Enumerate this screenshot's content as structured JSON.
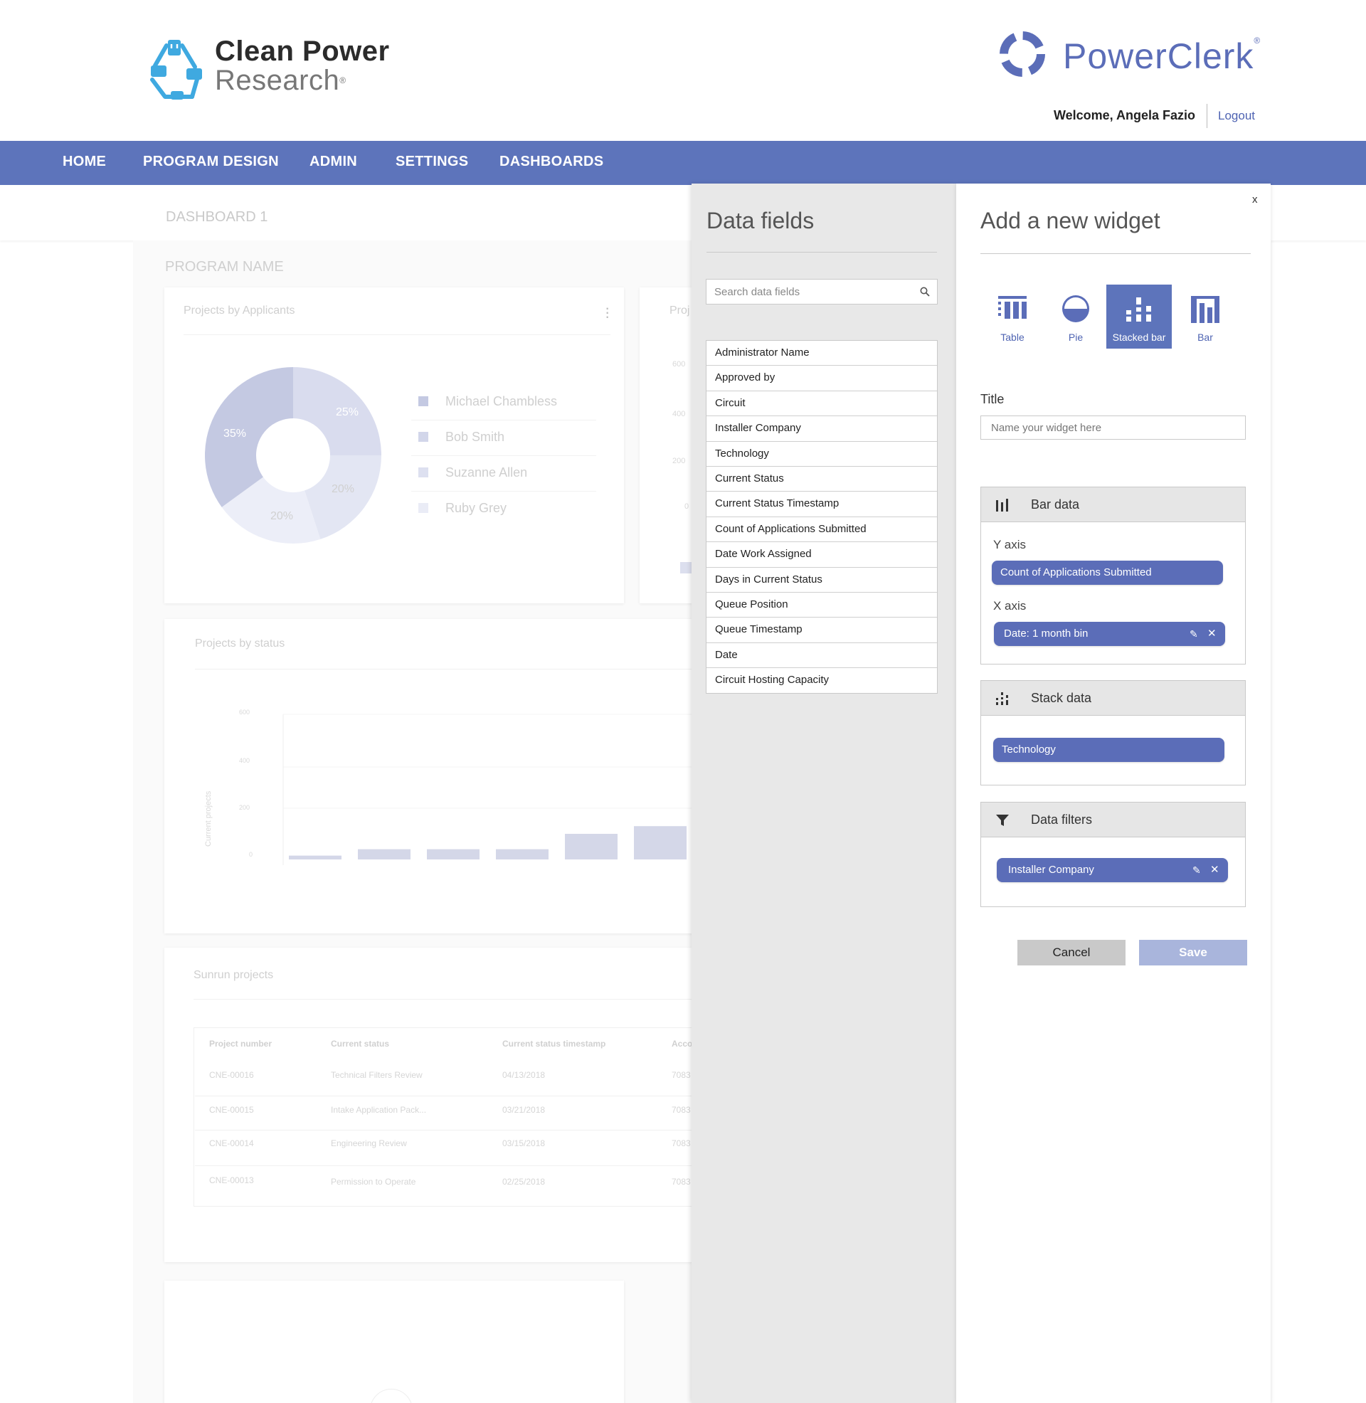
{
  "brand": {
    "company_line1": "Clean Power",
    "company_line2": "Research",
    "registered": "®",
    "product": "PowerClerk",
    "colors": {
      "accent": "#5d74bb",
      "pill": "#5b6db8",
      "logo_blue": "#3fa9e0"
    }
  },
  "user": {
    "welcome": "Welcome, Angela Fazio",
    "logout": "Logout"
  },
  "nav": {
    "items": [
      "HOME",
      "PROGRAM DESIGN",
      "ADMIN",
      "SETTINGS",
      "DASHBOARDS"
    ]
  },
  "dashboard": {
    "title": "DASHBOARD 1",
    "program_name": "PROGRAM NAME",
    "cards": {
      "applicants": {
        "title": "Projects by Applicants",
        "slices": [
          {
            "label": "25%",
            "value": 25,
            "color": "#d9dcee"
          },
          {
            "label": "20%",
            "value": 20,
            "color": "#e3e6f3"
          },
          {
            "label": "20%",
            "value": 20,
            "color": "#eceef8"
          },
          {
            "label": "35%",
            "value": 35,
            "color": "#c4c9e2"
          }
        ],
        "legend": [
          {
            "name": "Michael Chambless",
            "color": "#c4c9e2"
          },
          {
            "name": "Bob Smith",
            "color": "#d2d6ea"
          },
          {
            "name": "Suzanne Allen",
            "color": "#dde0f0"
          },
          {
            "name": "Ruby Grey",
            "color": "#eaecf6"
          }
        ]
      },
      "second": {
        "title": "Proj",
        "ticks": [
          "600",
          "400",
          "200",
          "0"
        ]
      },
      "status": {
        "title": "Projects by status",
        "ylabel": "Current projects",
        "ticks": [
          "600",
          "400",
          "200",
          "0"
        ],
        "bar_values": [
          15,
          40,
          40,
          40,
          100,
          130
        ]
      },
      "sunrun": {
        "title": "Sunrun projects",
        "headers": [
          "Project number",
          "Current status",
          "Current status timestamp",
          "Acco"
        ],
        "rows": [
          [
            "CNE-00016",
            "Technical Filters Review",
            "04/13/2018",
            "7083"
          ],
          [
            "CNE-00015",
            "Intake Application Pack...",
            "03/21/2018",
            "7083"
          ],
          [
            "CNE-00014",
            "Engineering Review",
            "03/15/2018",
            "7083"
          ],
          [
            "CNE-00013",
            "Permission to Operate",
            "02/25/2018",
            "7083"
          ]
        ]
      }
    }
  },
  "data_fields": {
    "title": "Data fields",
    "search_placeholder": "Search data fields",
    "items": [
      "Administrator Name",
      "Approved by",
      "Circuit",
      "Installer Company",
      "Technology",
      "Current Status",
      "Current Status Timestamp",
      "Count of Applications Submitted",
      "Date Work Assigned",
      "Days in Current Status",
      "Queue Position",
      "Queue Timestamp",
      "Date",
      "Circuit Hosting Capacity"
    ]
  },
  "widget": {
    "close": "x",
    "title": "Add a new widget",
    "types": [
      {
        "label": "Table",
        "icon": "table-icon",
        "active": false
      },
      {
        "label": "Pie",
        "icon": "pie-icon",
        "active": false
      },
      {
        "label": "Stacked bar",
        "icon": "stacked-bar-icon",
        "active": true
      },
      {
        "label": "Bar",
        "icon": "bar-icon",
        "active": false
      }
    ],
    "title_label": "Title",
    "title_placeholder": "Name your widget here",
    "bar_data": {
      "heading": "Bar data",
      "y_label": "Y axis",
      "y_value": "Count of Applications Submitted",
      "x_label": "X axis",
      "x_value": "Date: 1 month bin"
    },
    "stack_data": {
      "heading": "Stack data",
      "value": "Technology"
    },
    "data_filters": {
      "heading": "Data filters",
      "value": "Installer Company"
    },
    "cancel": "Cancel",
    "save": "Save"
  }
}
